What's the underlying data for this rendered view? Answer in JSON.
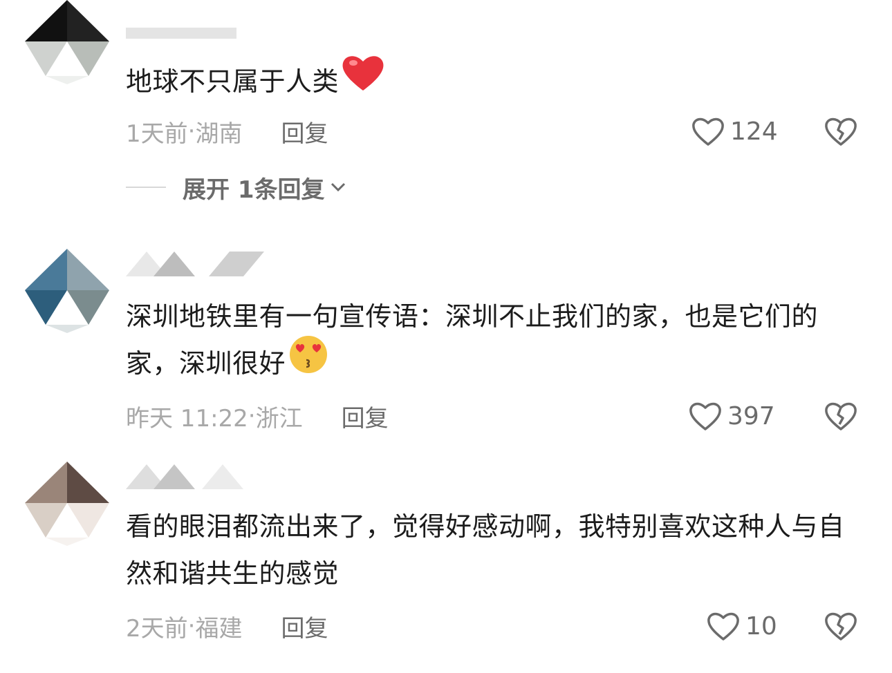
{
  "comments": [
    {
      "text": "地球不只属于人类",
      "emoji": "red-heart",
      "time": "1天前",
      "location": "湖南",
      "reply_label": "回复",
      "likes": "124",
      "expand_label": "展开 1条回复"
    },
    {
      "text": "深圳地铁里有一句宣传语：深圳不止我们的家，也是它们的家，深圳很好",
      "emoji": "heart-eyes-kiss",
      "time": "昨天 11:22",
      "location": "浙江",
      "reply_label": "回复",
      "likes": "397"
    },
    {
      "text": "看的眼泪都流出来了，觉得好感动啊，我特别喜欢这种人与自然和谐共生的感觉",
      "time": "2天前",
      "location": "福建",
      "reply_label": "回复",
      "likes": "10"
    }
  ],
  "separator": " · ",
  "colors": {
    "text": "#1c1c1c",
    "meta": "#a8a8a8",
    "action": "#6b6b6b",
    "heart": "#e8323c"
  }
}
